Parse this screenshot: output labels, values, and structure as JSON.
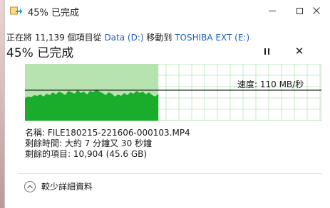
{
  "window": {
    "title": "45% 已完成"
  },
  "header": {
    "copy_prefix": "正在將 11,139 個項目從 ",
    "source": "Data (D:)",
    "copy_middle": " 移動到 ",
    "destination": "TOSHIBA EXT (E:)",
    "percent_text": "45% 已完成"
  },
  "controls": {
    "stop_glyph": "✕"
  },
  "graph": {
    "progress_percent": 45,
    "speed_text": "速度: 110 MB/秒",
    "colors": {
      "completed_area": "#b7e3b0",
      "throughput_fill": "#1aac2b",
      "current_speed_line": "#000000",
      "grid": "#c6e8c6"
    }
  },
  "details": {
    "name": "名稱: FILE180215-221606-000103.MP4",
    "time_remaining": "剩餘時間: 大約 7 分鐘又 30 秒鐘",
    "items_remaining": "剩餘的項目: 10,904 (45.6 GB)"
  },
  "footer": {
    "less_details_label": "較少詳細資料"
  },
  "icons": {
    "app": "copy-arrow-icon",
    "minimize": "minimize-icon",
    "maximize": "maximize-icon",
    "close": "close-icon",
    "pause": "pause-icon",
    "stop": "stop-icon",
    "less_details": "chevron-up-icon"
  }
}
